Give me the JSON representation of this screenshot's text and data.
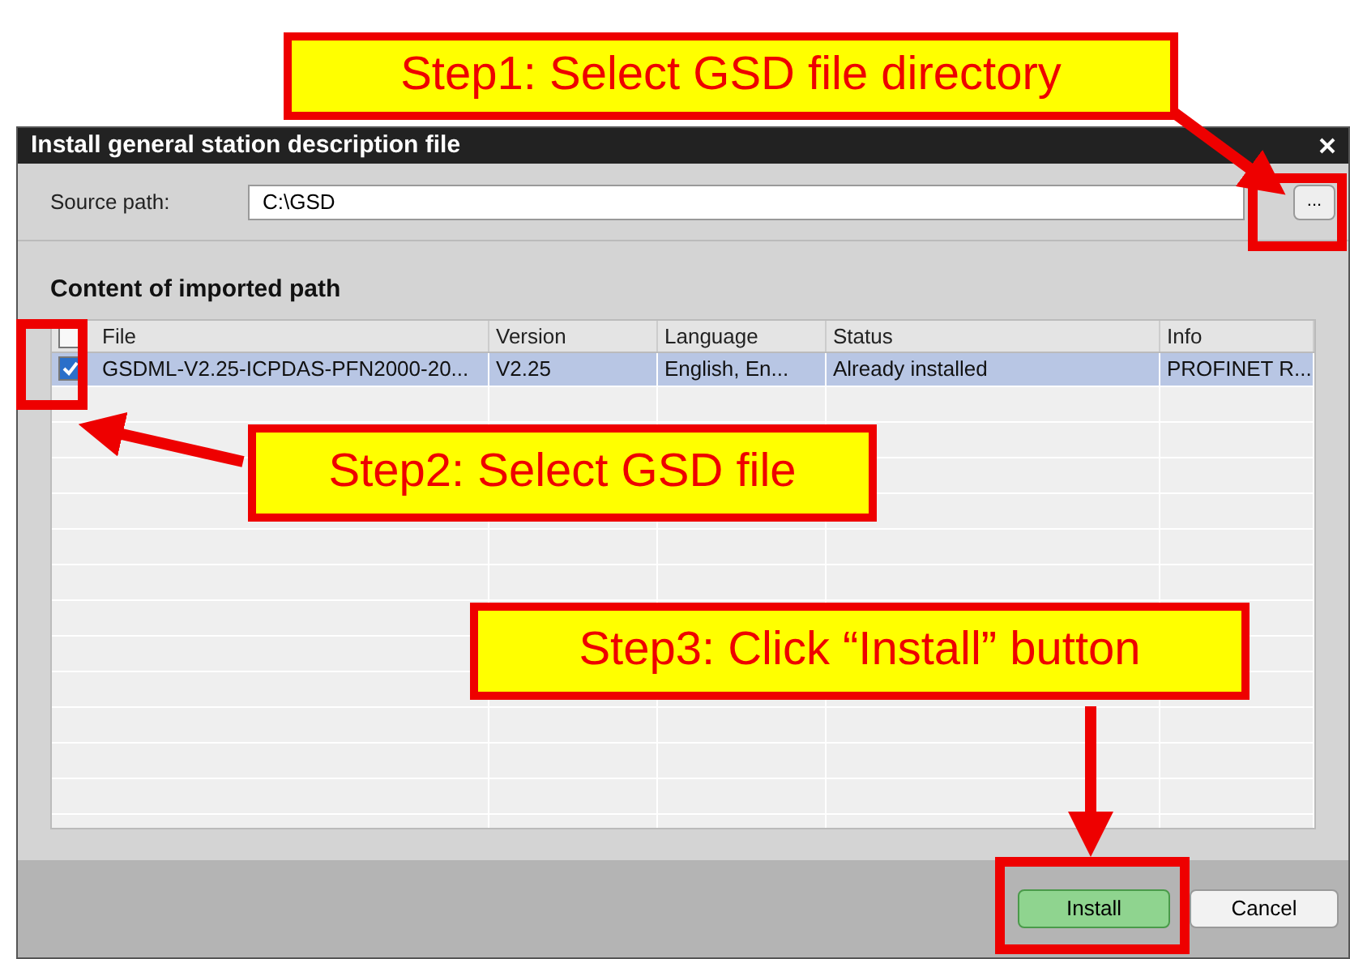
{
  "window": {
    "title": "Install general station description file"
  },
  "source_path": {
    "label": "Source path:",
    "value": "C:\\GSD",
    "browse_button": "..."
  },
  "section_title": "Content of imported path",
  "table": {
    "select_all": {
      "checked": false
    },
    "columns": [
      "File",
      "Version",
      "Language",
      "Status",
      "Info"
    ],
    "rows": [
      {
        "checked": true,
        "selected": true,
        "cells": [
          "GSDML-V2.25-ICPDAS-PFN2000-20...",
          "V2.25",
          "English, En...",
          "Already installed",
          "PROFINET R..."
        ]
      }
    ]
  },
  "buttons": [
    {
      "label": "Install",
      "kind": "primary"
    },
    {
      "label": "Cancel",
      "kind": "secondary"
    }
  ],
  "annotations": [
    {
      "text": "Step1: Select GSD file directory"
    },
    {
      "text": "Step2: Select GSD file"
    },
    {
      "text": "Step3: Click “Install” button"
    }
  ]
}
